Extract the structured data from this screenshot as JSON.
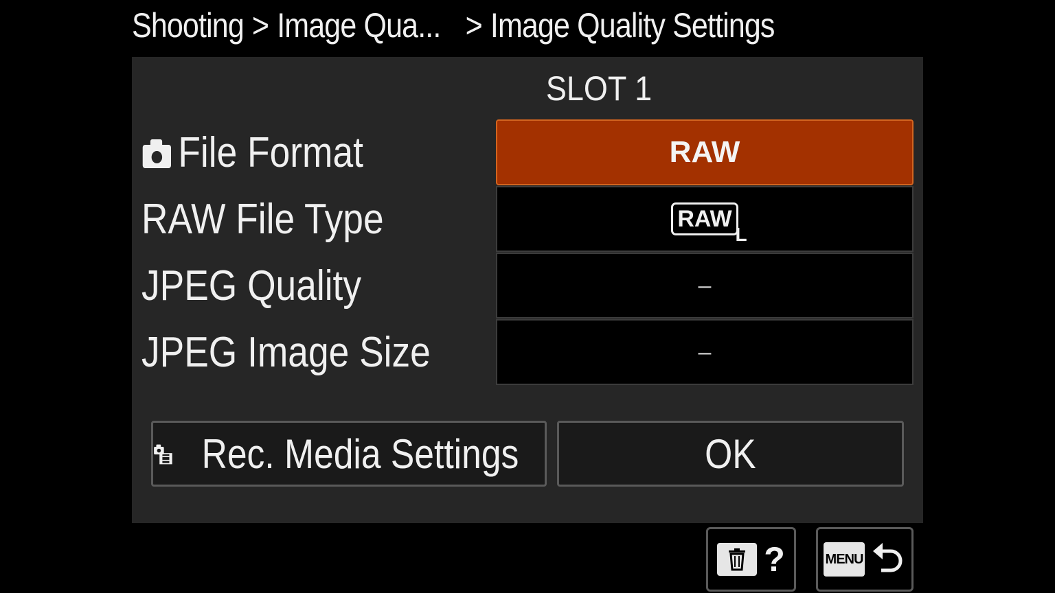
{
  "breadcrumb": {
    "root": "Shooting",
    "separator": ">",
    "mid": "Image Qua...",
    "current": "Image Quality Settings"
  },
  "panel": {
    "slot_label": "SLOT 1",
    "rows": [
      {
        "label": "File Format",
        "icon": "camera-icon",
        "value": "RAW"
      },
      {
        "label": "RAW File Type",
        "value_badge": "RAW",
        "value_sub": "L"
      },
      {
        "label": "JPEG Quality",
        "value": "–"
      },
      {
        "label": "JPEG Image Size",
        "value": "–"
      }
    ]
  },
  "buttons": {
    "media_settings": "Rec. Media Settings",
    "ok": "OK"
  },
  "hardware": {
    "help": "?",
    "menu": "MENU"
  },
  "colors": {
    "selected_bg": "#a33100",
    "selected_border": "#d3641f",
    "panel_bg": "#262626"
  }
}
